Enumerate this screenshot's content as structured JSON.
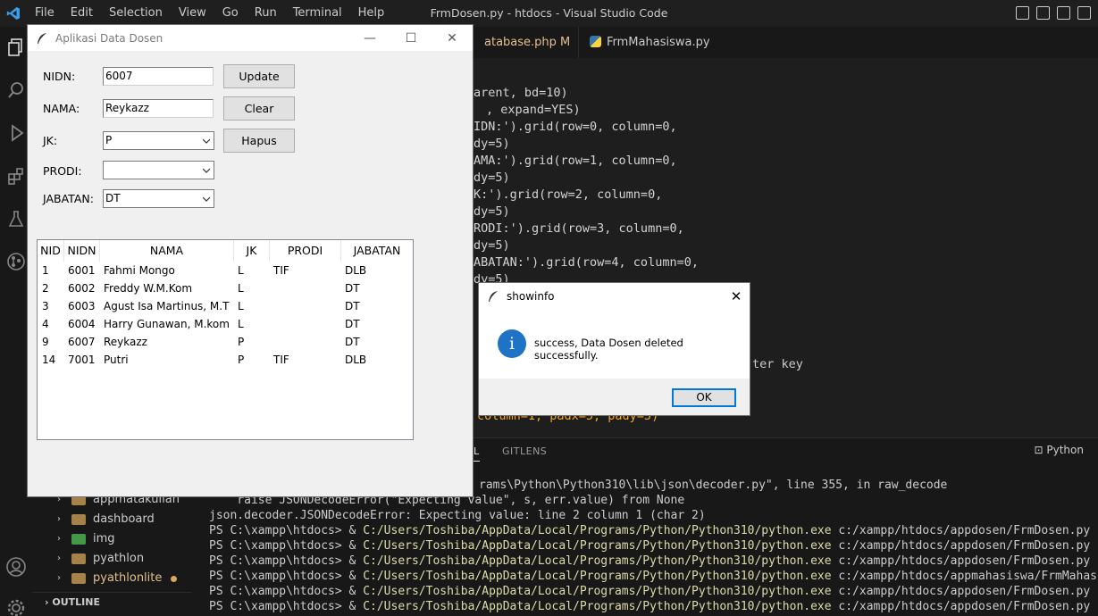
{
  "vscode": {
    "menu": [
      "File",
      "Edit",
      "Selection",
      "View",
      "Go",
      "Run",
      "Terminal",
      "Help"
    ],
    "window_title": "FrmDosen.py - htdocs - Visual Studio Code",
    "tabs": [
      {
        "label": "atabase.php",
        "modified": "M"
      },
      {
        "label": "FrmMahasiswa.py"
      }
    ],
    "code_lines": [
      {
        "text": "arent, bd=10)"
      },
      {
        "text": ", expand=YES)"
      },
      {
        "text": "IDN:').grid(row=0, column=0,"
      },
      {
        "text": "dy=5)"
      },
      {
        "text": "AMA:').grid(row=1, column=0,"
      },
      {
        "text": "dy=5)"
      },
      {
        "text": "K:').grid(row=2, column=0,"
      },
      {
        "text": "dy=5)"
      },
      {
        "text": "RODI:').grid(row=3, column=0,"
      },
      {
        "text": "dy=5)"
      },
      {
        "text": "ABATAN:').grid(row=4, column=0,"
      },
      {
        "text": "dy=5)"
      }
    ],
    "code_fragment_enter": "ter key",
    "code_fragment_bottom": "column=1, padx=5, pady=5)",
    "panel": {
      "tabs": [
        "AL",
        "GITLENS"
      ],
      "terminal_label": "Python"
    },
    "terminal_lines": [
      {
        "a": "rams\\Python\\Python310\\lib\\json\\decoder.py\", line 355, in raw_decode",
        "b": "",
        "c": ""
      },
      {
        "a": "    raise JSONDecodeError(\"Expecting value\", s, err.value) from None",
        "b": "",
        "c": ""
      },
      {
        "a": "json.decoder.JSONDecodeError: Expecting value: line 2 column 1 (char 2)",
        "b": "",
        "c": ""
      },
      {
        "a": "PS C:\\xampp\\htdocs> & ",
        "b": "C:/Users/Toshiba/AppData/Local/Programs/Python/Python310/python.exe",
        "c": " c:/xampp/htdocs/appdosen/FrmDosen.py"
      },
      {
        "a": "PS C:\\xampp\\htdocs> & ",
        "b": "C:/Users/Toshiba/AppData/Local/Programs/Python/Python310/python.exe",
        "c": " c:/xampp/htdocs/appdosen/FrmDosen.py"
      },
      {
        "a": "PS C:\\xampp\\htdocs> & ",
        "b": "C:/Users/Toshiba/AppData/Local/Programs/Python/Python310/python.exe",
        "c": " c:/xampp/htdocs/appdosen/FrmDosen.py"
      },
      {
        "a": "PS C:\\xampp\\htdocs> & ",
        "b": "C:/Users/Toshiba/AppData/Local/Programs/Python/Python310/python.exe",
        "c": " c:/xampp/htdocs/appmahasiswa/FrmMahasiswa.py"
      },
      {
        "a": "PS C:\\xampp\\htdocs> & ",
        "b": "C:/Users/Toshiba/AppData/Local/Programs/Python/Python310/python.exe",
        "c": " c:/xampp/htdocs/appdosen/FrmDosen.py"
      },
      {
        "a": "PS C:\\xampp\\htdocs> & ",
        "b": "C:/Users/Toshiba/AppData/Local/Programs/Python/Python310/python.exe",
        "c": " c:/xampp/htdocs/appdosen/FrmDosen.py"
      }
    ],
    "explorer": {
      "items": [
        "appmatakuliah",
        "dashboard",
        "img",
        "pyathlon",
        "pyathlonlite"
      ],
      "outline_label": "OUTLINE"
    }
  },
  "app": {
    "title": "Aplikasi Data Dosen",
    "labels": {
      "nidn": "NIDN:",
      "nama": "NAMA:",
      "jk": "JK:",
      "prodi": "PRODI:",
      "jabatan": "JABATAN:"
    },
    "values": {
      "nidn": "6007",
      "nama": "Reykazz",
      "jk": "P",
      "prodi": "",
      "jabatan": "DT"
    },
    "buttons": {
      "update": "Update",
      "clear": "Clear",
      "hapus": "Hapus"
    },
    "table": {
      "columns": [
        "NID",
        "NIDN",
        "NAMA",
        "JK",
        "PRODI",
        "JABATAN"
      ],
      "rows": [
        [
          "1",
          "6001",
          "Fahmi Mongo",
          "L",
          "TIF",
          "DLB"
        ],
        [
          "2",
          "6002",
          "Freddy W.M.Kom",
          "L",
          "",
          "DT"
        ],
        [
          "3",
          "6003",
          "Agust Isa Martinus, M.T",
          "L",
          "",
          "DT"
        ],
        [
          "4",
          "6004",
          "Harry Gunawan, M.kom",
          "L",
          "",
          "DT"
        ],
        [
          "9",
          "6007",
          "Reykazz",
          "P",
          "",
          "DT"
        ],
        [
          "14",
          "7001",
          "Putri",
          "P",
          "TIF",
          "DLB"
        ]
      ]
    }
  },
  "dialog": {
    "title": "showinfo",
    "message": "success, Data Dosen deleted successfully.",
    "ok_label": "OK"
  }
}
